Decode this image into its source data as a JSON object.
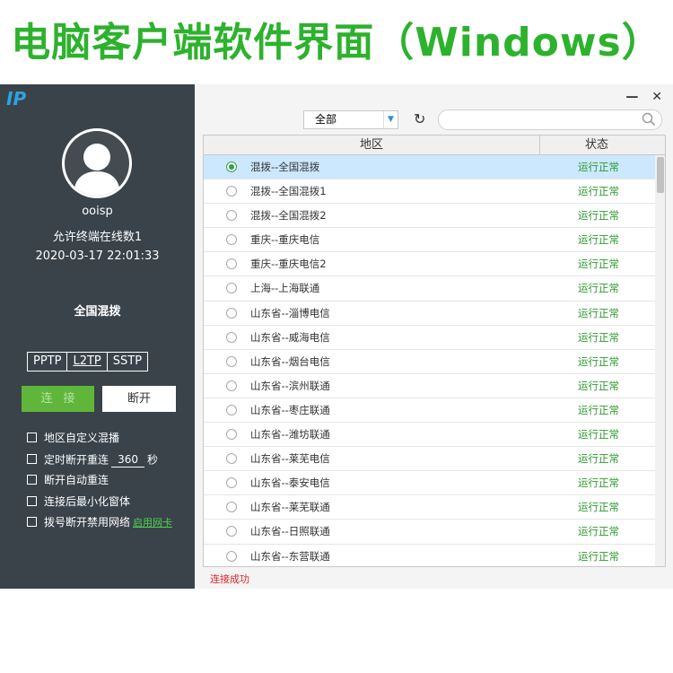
{
  "banner": {
    "title": "电脑客户端软件界面（Windows）"
  },
  "colors": {
    "accent": "#2db22d",
    "sidebar_bg": "#3a434a",
    "status_ok": "#2c9a2c",
    "error": "#d9242b",
    "selected_row": "#cce8ff"
  },
  "sidebar": {
    "logo": "IP",
    "username": "ooisp",
    "allowed_text": "允许终端在线数1",
    "datetime": "2020-03-17 22:01:33",
    "region": "全国混拨",
    "protocols": [
      {
        "label": "PPTP",
        "active": false
      },
      {
        "label": "L2TP",
        "active": true
      },
      {
        "label": "SSTP",
        "active": false
      }
    ],
    "connect_label": "连接",
    "disconnect_label": "断开",
    "options": {
      "custom_region": "地区自定义混播",
      "timed_reconnect": "定时断开重连",
      "timed_reconnect_value": "360",
      "timed_reconnect_unit": "秒",
      "auto_reconnect": "断开自动重连",
      "minimize_after_connect": "连接后最小化窗体",
      "disable_network": "拨号断开禁用网络",
      "enable_nic_link": "启用网卡"
    }
  },
  "window": {
    "minimize": "—",
    "close": "✕"
  },
  "toolbar": {
    "filter_value": "全部",
    "search_placeholder": ""
  },
  "table": {
    "headers": {
      "region": "地区",
      "status": "状态"
    },
    "rows": [
      {
        "name": "混拨--全国混拨",
        "status": "运行正常",
        "selected": true
      },
      {
        "name": "混拨--全国混拨1",
        "status": "运行正常"
      },
      {
        "name": "混拨--全国混拨2",
        "status": "运行正常"
      },
      {
        "name": "重庆--重庆电信",
        "status": "运行正常"
      },
      {
        "name": "重庆--重庆电信2",
        "status": "运行正常"
      },
      {
        "name": "上海--上海联通",
        "status": "运行正常"
      },
      {
        "name": "山东省--淄博电信",
        "status": "运行正常"
      },
      {
        "name": "山东省--威海电信",
        "status": "运行正常"
      },
      {
        "name": "山东省--烟台电信",
        "status": "运行正常"
      },
      {
        "name": "山东省--滨州联通",
        "status": "运行正常"
      },
      {
        "name": "山东省--枣庄联通",
        "status": "运行正常"
      },
      {
        "name": "山东省--潍坊联通",
        "status": "运行正常"
      },
      {
        "name": "山东省--莱芜电信",
        "status": "运行正常"
      },
      {
        "name": "山东省--泰安电信",
        "status": "运行正常"
      },
      {
        "name": "山东省--莱芜联通",
        "status": "运行正常"
      },
      {
        "name": "山东省--日照联通",
        "status": "运行正常"
      },
      {
        "name": "山东省--东营联通",
        "status": "运行正常"
      }
    ]
  },
  "statusbar": {
    "message": "连接成功"
  }
}
